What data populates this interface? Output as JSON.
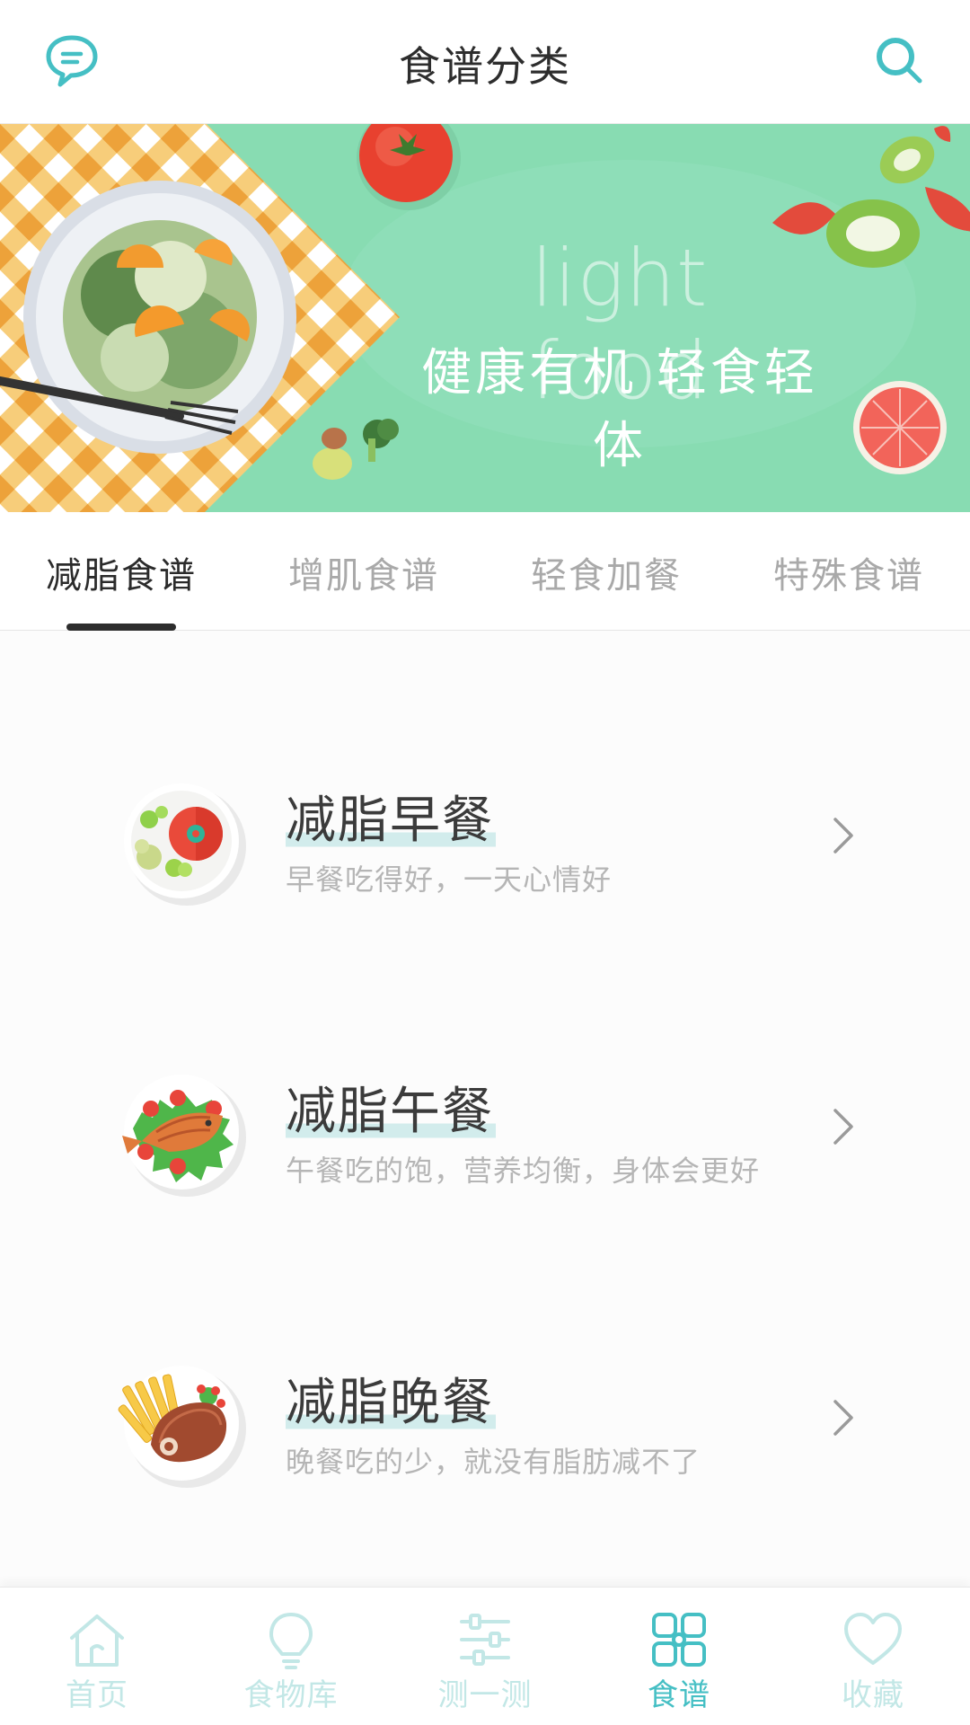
{
  "header": {
    "title": "食谱分类",
    "message_icon": "message-bubble-icon",
    "search_icon": "search-icon"
  },
  "banner": {
    "english_text": "light food",
    "chinese_text": "健康有机 轻食轻体"
  },
  "tabs": [
    {
      "label": "减脂食谱",
      "active": true
    },
    {
      "label": "增肌食谱",
      "active": false
    },
    {
      "label": "轻食加餐",
      "active": false
    },
    {
      "label": "特殊食谱",
      "active": false
    }
  ],
  "items": [
    {
      "title": "减脂早餐",
      "subtitle": "早餐吃得好，一天心情好",
      "icon": "breakfast-plate-icon"
    },
    {
      "title": "减脂午餐",
      "subtitle": "午餐吃的饱，营养均衡，身体会更好",
      "icon": "fish-plate-icon"
    },
    {
      "title": "减脂晚餐",
      "subtitle": "晚餐吃的少，就没有脂肪减不了",
      "icon": "steak-plate-icon"
    }
  ],
  "bottom_nav": [
    {
      "label": "首页",
      "icon": "home-icon",
      "active": false
    },
    {
      "label": "食物库",
      "icon": "lightbulb-icon",
      "active": false
    },
    {
      "label": "测一测",
      "icon": "sliders-icon",
      "active": false
    },
    {
      "label": "食谱",
      "icon": "grid-icon",
      "active": true
    },
    {
      "label": "收藏",
      "icon": "heart-icon",
      "active": false
    }
  ],
  "colors": {
    "accent": "#45bfc4",
    "inactive_nav": "#c2e7e6",
    "banner_green": "#88dcb2",
    "title_text": "#2d2d2d",
    "muted_text": "#b5b5b5"
  }
}
